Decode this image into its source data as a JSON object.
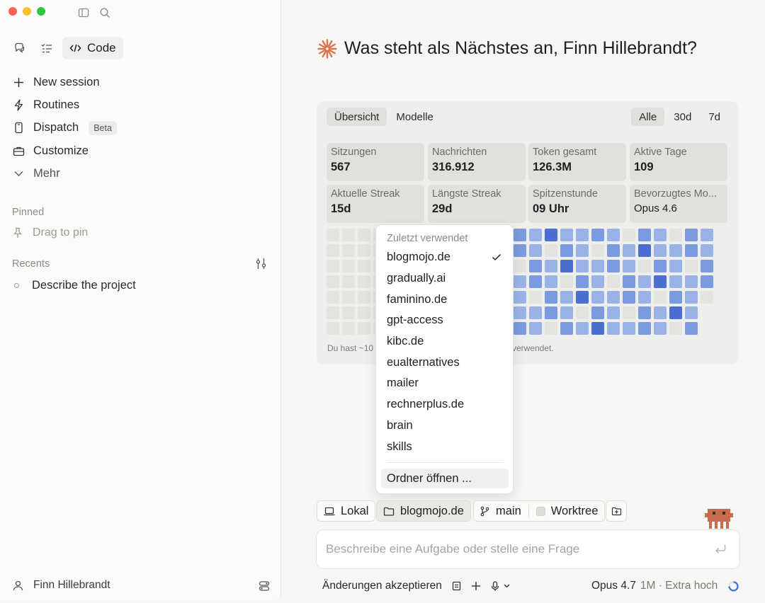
{
  "sidebar": {
    "mode_code_label": "Code",
    "nav": [
      {
        "label": "New session",
        "icon": "plus-icon"
      },
      {
        "label": "Routines",
        "icon": "bolt-icon"
      },
      {
        "label": "Dispatch",
        "icon": "phone-icon",
        "badge": "Beta"
      },
      {
        "label": "Customize",
        "icon": "briefcase-icon"
      },
      {
        "label": "Mehr",
        "icon": "chevron-down-icon"
      }
    ],
    "pinned_label": "Pinned",
    "drag_to_pin": "Drag to pin",
    "recents_label": "Recents",
    "recents": [
      "Describe the project"
    ],
    "user_name": "Finn Hillebrandt"
  },
  "main": {
    "greeting": "Was steht als Nächstes an, Finn Hillebrandt?",
    "tabs_left": [
      "Übersicht",
      "Modelle"
    ],
    "tabs_right": [
      "Alle",
      "30d",
      "7d"
    ],
    "stats": [
      {
        "label": "Sitzungen",
        "value": "567"
      },
      {
        "label": "Nachrichten",
        "value": "316.912"
      },
      {
        "label": "Token gesamt",
        "value": "126.3M"
      },
      {
        "label": "Aktive Tage",
        "value": "109"
      },
      {
        "label": "Aktuelle Streak",
        "value": "15d"
      },
      {
        "label": "Längste Streak",
        "value": "29d"
      },
      {
        "label": "Spitzenstunde",
        "value": "09 Uhr"
      },
      {
        "label": "Bevorzugtes Mo...",
        "value": "Opus 4.6"
      }
    ],
    "card_footer_left": "Du hast ~10",
    "card_footer_right": "verwendet."
  },
  "dropdown": {
    "header": "Zuletzt verwendet",
    "items": [
      "blogmojo.de",
      "gradually.ai",
      "faminino.de",
      "gpt-access",
      "kibc.de",
      "eualternatives",
      "mailer",
      "rechnerplus.de",
      "brain",
      "skills"
    ],
    "selected": "blogmojo.de",
    "open_folder": "Ordner öffnen ..."
  },
  "bottom": {
    "chip_local": "Lokal",
    "chip_folder": "blogmojo.de",
    "chip_branch": "main",
    "chip_worktree": "Worktree",
    "input_placeholder": "Beschreibe eine Aufgabe oder stelle eine Frage",
    "accept_changes": "Änderungen akzeptieren",
    "model": "Opus 4.7",
    "context": "1M · Extra hoch"
  },
  "colors": {
    "accent": "#d9744e",
    "heat_light": "#9ab4e8",
    "heat_mid": "#7b9be0",
    "heat_dark": "#4a6fd0",
    "heat_empty": "#e3e3e0"
  }
}
